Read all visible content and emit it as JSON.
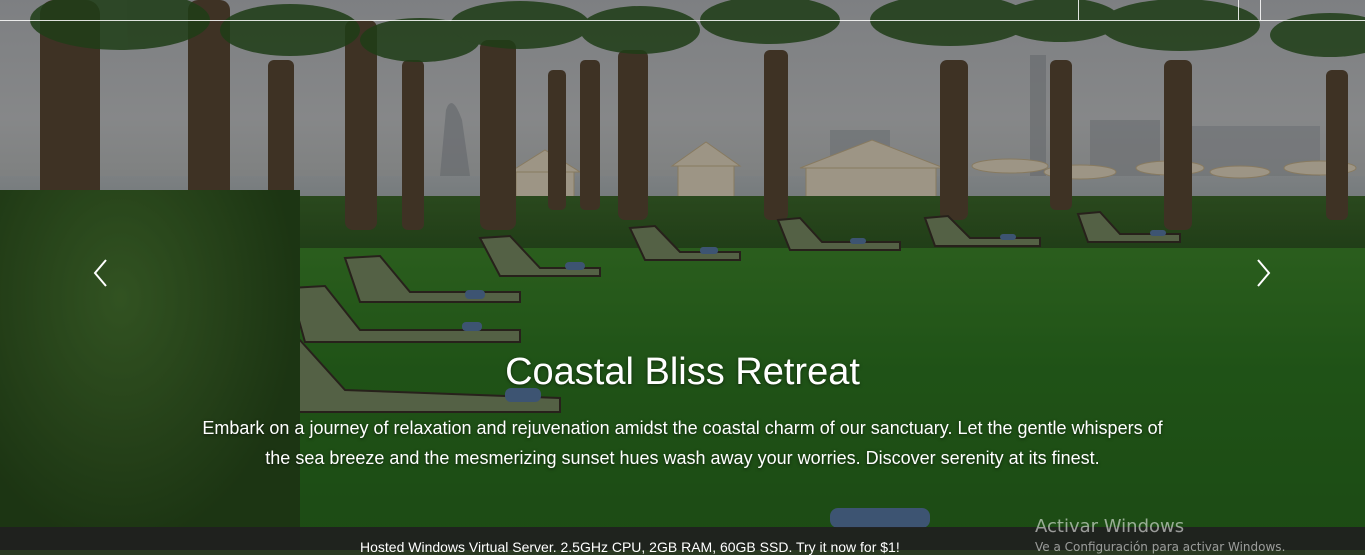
{
  "slide": {
    "title": "Coastal Bliss Retreat",
    "description": "Embark on a journey of relaxation and rejuvenation amidst the coastal charm of our sanctuary. Let the gentle whispers of the sea breeze and the mesmerizing sunset hues wash away your worries. Discover serenity at its finest."
  },
  "controls": {
    "prev_icon": "chevron-left-icon",
    "next_icon": "chevron-right-icon"
  },
  "ad_banner": {
    "text": "Hosted Windows Virtual Server. 2.5GHz CPU, 2GB RAM, 60GB SSD. Try it now for $1!"
  },
  "watermark": {
    "title": "Activar Windows",
    "subtitle": "Ve a Configuración para activar Windows."
  },
  "colors": {
    "text": "#ffffff",
    "bar": "#1f1f1f",
    "lawn": "#2f7a22"
  }
}
